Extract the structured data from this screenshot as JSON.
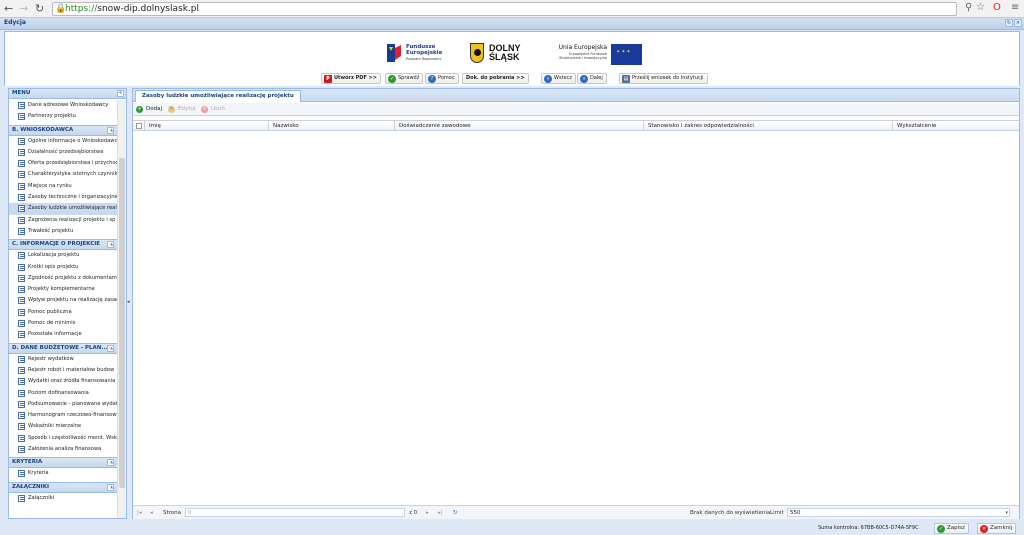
{
  "browser": {
    "url_scheme": "https://",
    "url_host": "snow-dip.dolnyslask.pl"
  },
  "app": {
    "title": "Edycja"
  },
  "logos": {
    "fe_line1": "Fundusze",
    "fe_line2": "Europejskie",
    "fe_sub": "Program Regionalny",
    "region_line1": "DOLNY",
    "region_line2": "ŚLĄSK",
    "ue_title": "Unia Europejska",
    "ue_sub1": "Europejskie Fundusze",
    "ue_sub2": "Strukturalne i Inwestycyjne"
  },
  "toolbar": {
    "pdf": "Utwórz PDF >>",
    "check": "Sprawdź",
    "help": "Pomoc",
    "docs": "Dok. do pobrania >>",
    "back": "Wstecz",
    "next": "Dalej",
    "send": "Prześlij wniosek do Instytucji"
  },
  "menu": {
    "header": "MENU",
    "top_items": [
      "Dane adresowe Wnioskodawcy",
      "Partnerzy projektu"
    ],
    "sections": [
      {
        "title": "B. WNIOSKODAWCA",
        "items": [
          "Ogólne informacje o Wnioskodawcy",
          "Działalność przedsiębiorstwa",
          "Oferta przedsiębiorstwa i przychody",
          "Charakterystyka istotnych czynników",
          "Miejsce na rynku",
          "Zasoby techniczne i organizacyjne",
          "Zasoby ludzkie umożliwiające realizację",
          "Zagrożenia realizacji projektu i sp",
          "Trwałość projektu"
        ]
      },
      {
        "title": "C. INFORMACJE O PROJEKCIE",
        "items": [
          "Lokalizacja projektu",
          "Krótki opis projektu",
          "Zgodność projektu z dokumentami",
          "Projekty komplementarne",
          "Wpływ projektu na realizację zasad",
          "Pomoc publiczna",
          "Pomoc de minimis",
          "Pozostałe informacje"
        ]
      },
      {
        "title": "D. DANE BUDŻETOWE - PLAN...",
        "items": [
          "Rejestr wydatków",
          "Rejestr robót i materiałów budow",
          "Wydatki oraz źródła finansowania",
          "Poziom dofinansowania",
          "Podsumowanie - planowane wydatki",
          "Harmonogram rzeczowo-finansowy",
          "Wskaźniki mierzalne",
          "Sposób i częstotliwość monit. Wsk",
          "Założenia analiza finansowa"
        ]
      },
      {
        "title": "KRYTERIA",
        "items": [
          "Kryteria"
        ]
      },
      {
        "title": "ZAŁĄCZNIKI",
        "items": [
          "Załączniki"
        ]
      }
    ],
    "selected": "Zasoby ludzkie umożliwiające realizację"
  },
  "main": {
    "tab": "Zasoby ludzkie umożliwiające realizację projektu",
    "add": "Dodaj",
    "edit": "Edytuj",
    "delete": "Usuń",
    "columns": [
      "Imię",
      "Nazwisko",
      "Doświadczenie zawodowe",
      "Stanowisko i zakres odpowiedzialności",
      "Wykształcenie"
    ]
  },
  "pager": {
    "page_label": "Strona",
    "of": "z 0",
    "empty": "Brak danych do wyświetlenia",
    "limit_label": "Limit",
    "limit_value": "550"
  },
  "footer": {
    "checksum": "Suma kontrolna: 67BB-60C5-D74A-5F9C",
    "save": "Zapisz",
    "close": "Zamknij"
  }
}
